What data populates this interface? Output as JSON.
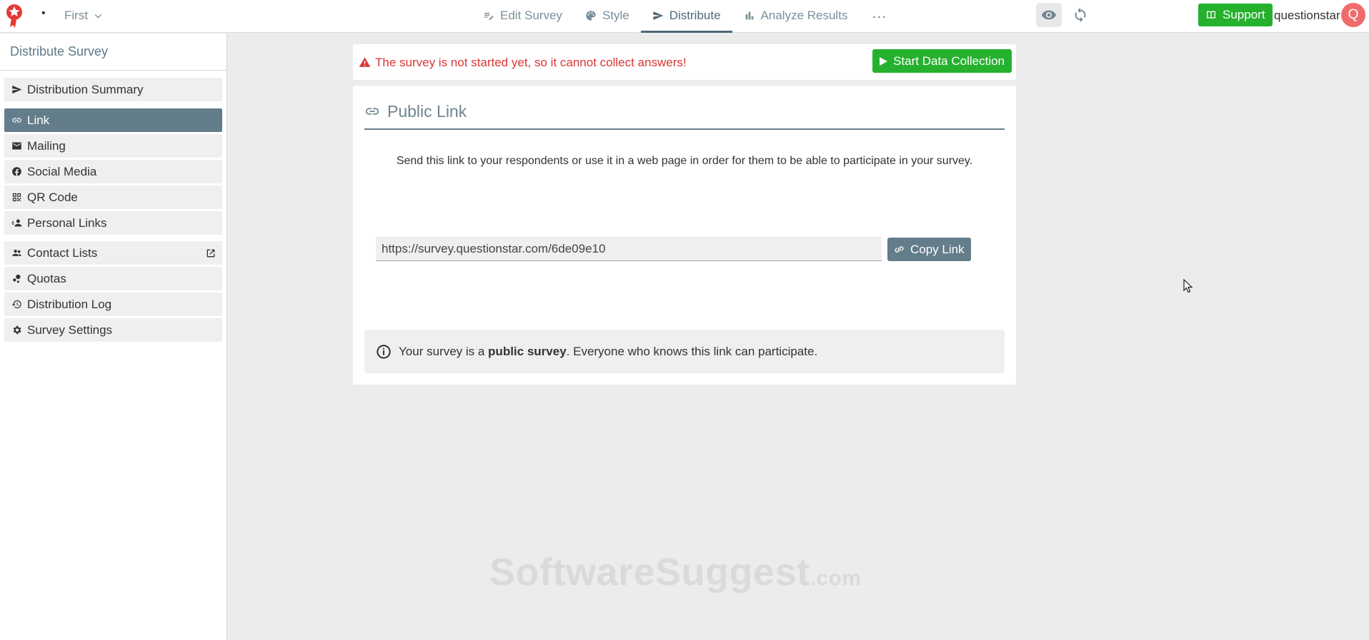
{
  "topbar": {
    "survey_name": "First",
    "nav": [
      {
        "label": "Edit Survey",
        "icon": "edit-icon"
      },
      {
        "label": "Style",
        "icon": "palette-icon"
      },
      {
        "label": "Distribute",
        "icon": "send-icon",
        "active": true
      },
      {
        "label": "Analyze Results",
        "icon": "bar-chart-icon"
      }
    ],
    "more_label": "···",
    "support_label": "Support",
    "username": "questionstar",
    "avatar_letter": "Q"
  },
  "sidebar": {
    "title": "Distribute Survey",
    "items": [
      {
        "label": "Distribution Summary",
        "icon": "send-icon"
      },
      {
        "label": "Link",
        "icon": "link-icon",
        "active": true
      },
      {
        "label": "Mailing",
        "icon": "mail-icon"
      },
      {
        "label": "Social Media",
        "icon": "facebook-icon"
      },
      {
        "label": "QR Code",
        "icon": "qr-code-icon"
      },
      {
        "label": "Personal Links",
        "icon": "person-link-icon"
      },
      {
        "label": "Contact Lists",
        "icon": "contacts-icon",
        "external": true
      },
      {
        "label": "Quotas",
        "icon": "quota-icon"
      },
      {
        "label": "Distribution Log",
        "icon": "history-icon"
      },
      {
        "label": "Survey Settings",
        "icon": "gear-icon"
      }
    ]
  },
  "alert": {
    "text": "The survey is not started yet, so it cannot collect answers!",
    "button_label": "Start Data Collection"
  },
  "public_link": {
    "title": "Public Link",
    "description": "Send this link to your respondents or use it in a web page in order for them to be able to participate in your survey.",
    "url": "https://survey.questionstar.com/6de09e10",
    "copy_label": "Copy Link",
    "info_prefix": "Your survey is a ",
    "info_bold": "public survey",
    "info_suffix": ". Everyone who knows this link can participate."
  },
  "watermark": {
    "main": "SoftwareSuggest",
    "suffix": ".com"
  },
  "colors": {
    "accent": "#637d8a",
    "green": "#25b02e",
    "alert_red": "#d93636",
    "avatar": "#f06c6c"
  }
}
